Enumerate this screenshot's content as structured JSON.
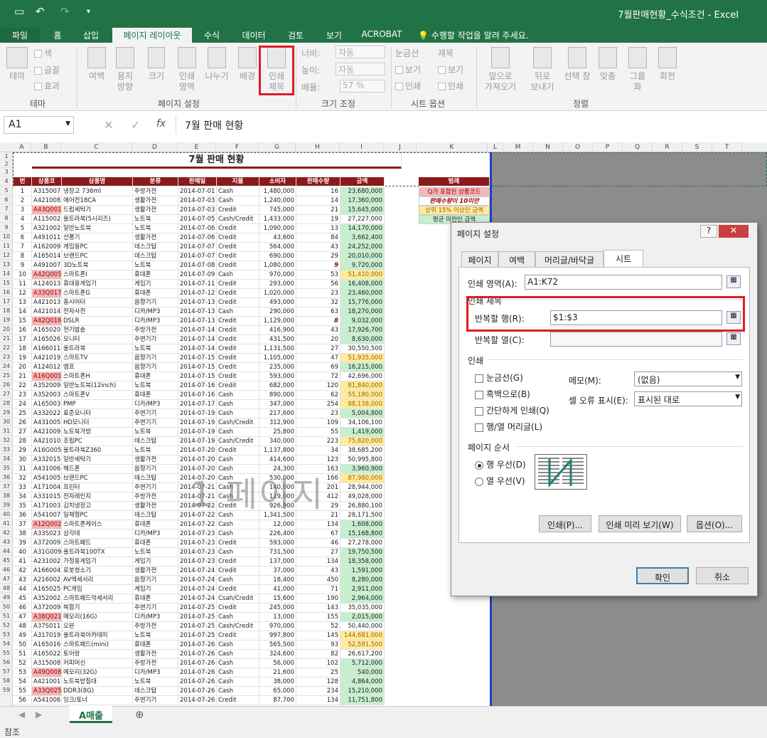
{
  "window": {
    "title": "7월판매현황_수식조건 - Excel"
  },
  "tabs": [
    "파일",
    "홈",
    "삽입",
    "페이지 레이아웃",
    "수식",
    "데이터",
    "검토",
    "보기",
    "ACROBAT"
  ],
  "tell_me": "수행할 작업을 알려 주세요.",
  "ribbon": {
    "theme": {
      "themes": "테마",
      "colors": "색",
      "fonts": "글꼴",
      "effects": "효과",
      "group": "테마"
    },
    "setup": {
      "margins": "여백",
      "orientation": "용지\n방향",
      "size": "크기",
      "print_area": "인쇄\n영역",
      "breaks": "나누기",
      "background": "배경",
      "print_titles": "인쇄\n제목",
      "group": "페이지 설정"
    },
    "scale": {
      "width_label": "너비:",
      "width_val": "자동",
      "height_label": "높이:",
      "height_val": "자동",
      "scale_label": "배율:",
      "scale_val": "57 %",
      "group": "크기 조정"
    },
    "sheet_opts": {
      "gridlines": "눈금선",
      "headings": "제목",
      "view": "보기",
      "print": "인쇄",
      "group": "시트 옵션"
    },
    "arrange": {
      "bring_forward": "앞으로\n가져오기",
      "send_backward": "뒤로\n보내기",
      "selection_pane": "선택 창",
      "align": "맞춤",
      "group_btn": "그룹\n화",
      "rotate": "회전",
      "group": "정렬"
    }
  },
  "formula_bar": {
    "name_box": "A1",
    "fx": "fx",
    "content": "7월 판매 현황"
  },
  "columns": [
    "A",
    "B",
    "C",
    "D",
    "E",
    "F",
    "G",
    "H",
    "I",
    "J",
    "K",
    "L",
    "M",
    "N",
    "O",
    "P",
    "Q",
    "R",
    "S",
    "T"
  ],
  "sheet": {
    "title": "7월 판매 현황",
    "headers": [
      "번",
      "상품코",
      "상품명",
      "분류",
      "판매일",
      "지불",
      "소비자",
      "판매수량",
      "금액",
      "",
      "범례"
    ],
    "rows": [
      [
        "1",
        "A315007",
        "냉장고 736ml",
        "주방가전",
        "2014-07-01",
        "Cash",
        "1,480,000",
        "16",
        "23,680,000"
      ],
      [
        "2",
        "A421008",
        "에어컨18CA",
        "생활가전",
        "2014-07-03",
        "Cash",
        "1,240,000",
        "14",
        "17,360,000"
      ],
      [
        "3",
        "A43Q001",
        "드럼세탁기",
        "생활가전",
        "2014-07-03",
        "Credit",
        "745,000",
        "21",
        "15,645,000"
      ],
      [
        "4",
        "A115002",
        "울트라북(5시리즈)",
        "노트북",
        "2014-07-05",
        "Cash/Credit",
        "1,433,000",
        "19",
        "27,227,000"
      ],
      [
        "5",
        "A321002",
        "일반노트북",
        "노트북",
        "2014-07-06",
        "Credit",
        "1,090,000",
        "13",
        "14,170,000"
      ],
      [
        "6",
        "A491011",
        "선풍기",
        "생활가전",
        "2014-07-06",
        "Credit",
        "43,600",
        "84",
        "3,662,400"
      ],
      [
        "7",
        "A162009",
        "게임용PC",
        "데스크탑",
        "2014-07-07",
        "Credit",
        "564,000",
        "43",
        "24,252,000"
      ],
      [
        "8",
        "A165014",
        "브랜드PC",
        "데스크탑",
        "2014-07-07",
        "Credit",
        "690,000",
        "29",
        "20,010,000"
      ],
      [
        "9",
        "A491007",
        "3D노트북",
        "노트북",
        "2014-07-08",
        "Credit",
        "1,080,000",
        "9",
        "9,720,000"
      ],
      [
        "10",
        "A42Q005",
        "스마트폰I",
        "휴대폰",
        "2014-07-09",
        "Cash",
        "970,000",
        "53",
        "51,410,000"
      ],
      [
        "11",
        "A124013",
        "휴대용게임기",
        "게임기",
        "2014-07-11",
        "Credit",
        "293,000",
        "56",
        "16,408,000"
      ],
      [
        "12",
        "A33Q017",
        "스마트폰G",
        "휴대폰",
        "2014-07-12",
        "Credit",
        "1,020,000",
        "23",
        "23,460,000"
      ],
      [
        "13",
        "A421013",
        "홈시어터",
        "음향기기",
        "2014-07-13",
        "Credit",
        "493,000",
        "32",
        "15,776,000"
      ],
      [
        "14",
        "A421014",
        "전자사전",
        "디카/MP3",
        "2014-07-13",
        "Cash",
        "290,000",
        "63",
        "18,270,000"
      ],
      [
        "15",
        "A42Q016",
        "DSLR",
        "디카/MP3",
        "2014-07-13",
        "Credit",
        "1,129,000",
        "8",
        "9,032,000"
      ],
      [
        "16",
        "A165020",
        "전기밥솥",
        "주방가전",
        "2014-07-14",
        "Credit",
        "416,900",
        "43",
        "17,926,700"
      ],
      [
        "17",
        "A165026",
        "모니터",
        "주변기기",
        "2014-07-14",
        "Credit",
        "431,500",
        "20",
        "8,630,000"
      ],
      [
        "18",
        "A166011",
        "울트라북",
        "노트북",
        "2014-07-14",
        "Credit",
        "1,131,500",
        "27",
        "30,550,500"
      ],
      [
        "19",
        "A421019",
        "스마트TV",
        "음향기기",
        "2014-07-15",
        "Credit",
        "1,105,000",
        "47",
        "51,935,000"
      ],
      [
        "20",
        "A124012",
        "앰프",
        "음향기기",
        "2014-07-15",
        "Credit",
        "235,000",
        "69",
        "16,215,000"
      ],
      [
        "21",
        "A16Q001",
        "스마트폰H",
        "휴대폰",
        "2014-07-15",
        "Credit",
        "593,000",
        "72",
        "42,696,000"
      ],
      [
        "22",
        "A352009",
        "일반노트북(12inch)",
        "노트북",
        "2014-07-16",
        "Credit",
        "682,000",
        "120",
        "81,840,000"
      ],
      [
        "23",
        "A352003",
        "스마트폰V",
        "휴대폰",
        "2014-07-16",
        "Cash",
        "890,000",
        "62",
        "55,180,000"
      ],
      [
        "24",
        "A165003",
        "PMP",
        "디카/MP3",
        "2014-07-17",
        "Cash",
        "347,000",
        "254",
        "88,138,000"
      ],
      [
        "25",
        "A332022",
        "표준모니터",
        "주변기기",
        "2014-07-19",
        "Cash",
        "217,600",
        "23",
        "5,004,800"
      ],
      [
        "26",
        "A431005",
        "HD모니터",
        "주변기기",
        "2014-07-19",
        "Cash/Credit",
        "312,900",
        "109",
        "34,106,100"
      ],
      [
        "27",
        "A421009",
        "노트북가방",
        "노트북",
        "2014-07-19",
        "Cash",
        "25,800",
        "55",
        "1,419,000"
      ],
      [
        "28",
        "A421010",
        "조립PC",
        "데스크탑",
        "2014-07-19",
        "Cash/Credit",
        "340,000",
        "223",
        "75,820,000"
      ],
      [
        "29",
        "A16G005",
        "울트라북Z360",
        "노트북",
        "2014-07-20",
        "Credit",
        "1,137,800",
        "34",
        "38,685,200"
      ],
      [
        "30",
        "A332015",
        "일반세탁기",
        "생활가전",
        "2014-07-20",
        "Cash",
        "414,600",
        "123",
        "50,995,800"
      ],
      [
        "31",
        "A431006",
        "헤드폰",
        "음향기기",
        "2014-07-20",
        "Cash",
        "24,300",
        "163",
        "3,960,900"
      ],
      [
        "32",
        "A541005",
        "브랜드PC",
        "데스크탑",
        "2014-07-20",
        "Cash",
        "530,000",
        "166",
        "87,980,000"
      ],
      [
        "33",
        "A171004",
        "프린터",
        "주변기기",
        "2014-07-21",
        "Cash",
        "140,000",
        "201",
        "28,944,000"
      ],
      [
        "34",
        "A331015",
        "전자레인지",
        "주방가전",
        "2014-07-21",
        "Cash",
        "119,000",
        "412",
        "49,028,000"
      ],
      [
        "35",
        "A171003",
        "김치냉장고",
        "생활가전",
        "2014-07-22",
        "Credit",
        "926,900",
        "29",
        "26,880,100"
      ],
      [
        "36",
        "A541007",
        "일체형PC",
        "데스크탑",
        "2014-07-22",
        "Cash",
        "1,341,500",
        "21",
        "28,171,500"
      ],
      [
        "37",
        "A12Q002",
        "스마트폰케이스",
        "휴대폰",
        "2014-07-22",
        "Cash",
        "12,000",
        "134",
        "1,608,000"
      ],
      [
        "38",
        "A33S023",
        "삼각대",
        "디카/MP3",
        "2014-07-23",
        "Cash",
        "226,400",
        "67",
        "15,168,800"
      ],
      [
        "39",
        "A372009",
        "스마트패드",
        "휴대폰",
        "2014-07-23",
        "Credit",
        "593,000",
        "46",
        "27,278,000"
      ],
      [
        "40",
        "A31G009",
        "울트라북100TX",
        "노트북",
        "2014-07-23",
        "Cash",
        "731,500",
        "27",
        "19,750,500"
      ],
      [
        "41",
        "A231002",
        "가정용게임기",
        "게임기",
        "2014-07-23",
        "Credit",
        "137,000",
        "134",
        "18,358,000"
      ],
      [
        "42",
        "A166004",
        "로봇청소기",
        "생활가전",
        "2014-07-24",
        "Credit",
        "37,000",
        "43",
        "1,591,000"
      ],
      [
        "43",
        "A216002",
        "AV엑세서리",
        "음향기기",
        "2014-07-24",
        "Cash",
        "18,400",
        "450",
        "8,280,000"
      ],
      [
        "44",
        "A165025",
        "PC게임",
        "게임기",
        "2014-07-24",
        "Credit",
        "41,000",
        "71",
        "2,911,000"
      ],
      [
        "45",
        "A352002",
        "스마트패드악세서리",
        "휴대폰",
        "2014-07-24",
        "Csah/Credit",
        "15,600",
        "190",
        "2,964,000"
      ],
      [
        "46",
        "A372009",
        "복합기",
        "주변기기",
        "2014-07-25",
        "Credit",
        "245,000",
        "143",
        "35,035,000"
      ],
      [
        "47",
        "A38Q021",
        "메모리(16G)",
        "디카/MP3",
        "2014-07-25",
        "Cash",
        "13,000",
        "155",
        "2,015,000"
      ],
      [
        "48",
        "A37S011",
        "오븐",
        "주방가전",
        "2014-07-25",
        "Cash/Credit",
        "970,000",
        "52",
        "50,440,000"
      ],
      [
        "49",
        "A317019",
        "울트라북아카데미",
        "노트북",
        "2014-07-25",
        "Credit",
        "997,800",
        "145",
        "144,681,000"
      ],
      [
        "50",
        "A165016",
        "스마트패드(mini)",
        "휴대폰",
        "2014-07-26",
        "Cash",
        "565,500",
        "93",
        "52,591,500"
      ],
      [
        "51",
        "A165022",
        "토어랑",
        "생활가전",
        "2014-07-26",
        "Cash",
        "324,600",
        "82",
        "26,617,200"
      ],
      [
        "52",
        "A315008",
        "커피머신",
        "주방가전",
        "2014-07-26",
        "Cash",
        "56,000",
        "102",
        "5,712,000"
      ],
      [
        "53",
        "A49Q008",
        "메모리(32G)",
        "디카/MP3",
        "2014-07-26",
        "Cash",
        "21,600",
        "25",
        "540,000"
      ],
      [
        "54",
        "A421001",
        "노트북받침대",
        "노트북",
        "2014-07-26",
        "Cash",
        "38,000",
        "128",
        "4,864,000"
      ],
      [
        "55",
        "A33Q025",
        "DDR3(8G)",
        "데스크탑",
        "2014-07-26",
        "Cash",
        "65,000",
        "234",
        "15,210,000"
      ],
      [
        "56",
        "A541006",
        "잉크/토너",
        "주변기기",
        "2014-07-26",
        "Credit",
        "87,700",
        "134",
        "11,751,800"
      ]
    ],
    "legend": [
      "Q가 포함된 상품코드",
      "판매수량이 10미만",
      "상위 15% 이상인 금액",
      "평균 미만인 금액"
    ],
    "watermark": "1 페이지"
  },
  "dialog": {
    "title": "페이지 설정",
    "help": "?",
    "close": "✕",
    "tabs": [
      "페이지",
      "여백",
      "머리글/바닥글",
      "시트"
    ],
    "print_area_label": "인쇄 영역(A):",
    "print_area_val": "A1:K72",
    "print_titles_section": "인쇄 제목",
    "repeat_rows_label": "반복할 행(R):",
    "repeat_rows_val": "$1:$3",
    "repeat_cols_label": "반복할 열(C):",
    "repeat_cols_val": "",
    "print_section": "인쇄",
    "gridlines": "눈금선(G)",
    "black_white": "흑백으로(B)",
    "draft": "간단하게 인쇄(Q)",
    "headings": "행/열 머리글(L)",
    "comments_label": "메모(M):",
    "comments_val": "(없음)",
    "errors_label": "셀 오류 표시(E):",
    "errors_val": "표시된 대로",
    "order_section": "페이지 순서",
    "down_then_over": "행 우선(D)",
    "over_then_down": "열 우선(V)",
    "print_btn": "인쇄(P)...",
    "preview_btn": "인쇄 미리 보기(W)",
    "options_btn": "옵션(O)...",
    "ok": "확인",
    "cancel": "취소"
  },
  "sheet_tab": "A매출",
  "status": "참조"
}
